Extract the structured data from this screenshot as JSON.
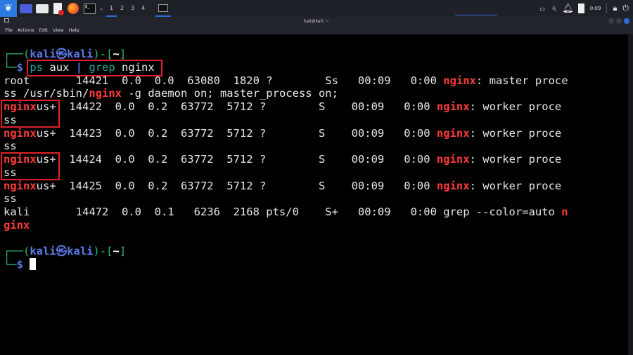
{
  "taskbar": {
    "workspaces": [
      "1",
      "2",
      "3",
      "4"
    ],
    "clock": "0:09"
  },
  "window": {
    "title": "kali@kali: ~",
    "menu": [
      "File",
      "Actions",
      "Edit",
      "View",
      "Help"
    ]
  },
  "prompt": {
    "top_open": "┌──(",
    "user": "kali㉿kali",
    "mid": ")-[",
    "dir": "~",
    "close": "]",
    "bottom": "└─",
    "dollar": "$"
  },
  "command": {
    "ps": "ps",
    "args": " aux ",
    "pipe": "|",
    "grep": "grep",
    "pattern": " nginx"
  },
  "output": [
    {
      "pre": "root       14421  0.0  0.0  63080  1820 ?        Ss   00:09   0:00 ",
      "hl": "nginx",
      "post": ": master proce"
    },
    {
      "pre": "ss /usr/sbin/",
      "hl": "nginx",
      "post": " -g daemon on; master_process on;"
    },
    {
      "pre": "",
      "hl": "nginx",
      "post": "us+  14422  0.0  0.2  63772  5712 ?        S    00:09   0:00 ",
      "hl2": "nginx",
      "post2": ": worker proce"
    },
    {
      "pre": "ss",
      "hl": "",
      "post": ""
    },
    {
      "pre": "",
      "hl": "nginx",
      "post": "us+  14423  0.0  0.2  63772  5712 ?        S    00:09   0:00 ",
      "hl2": "nginx",
      "post2": ": worker proce"
    },
    {
      "pre": "ss",
      "hl": "",
      "post": ""
    },
    {
      "pre": "",
      "hl": "nginx",
      "post": "us+  14424  0.0  0.2  63772  5712 ?        S    00:09   0:00 ",
      "hl2": "nginx",
      "post2": ": worker proce"
    },
    {
      "pre": "ss",
      "hl": "",
      "post": ""
    },
    {
      "pre": "",
      "hl": "nginx",
      "post": "us+  14425  0.0  0.2  63772  5712 ?        S    00:09   0:00 ",
      "hl2": "nginx",
      "post2": ": worker proce"
    },
    {
      "pre": "ss",
      "hl": "",
      "post": ""
    },
    {
      "pre": "kali       14472  0.0  0.1   6236  2168 pts/0    S+   00:09   0:00 grep --color=auto ",
      "hl": "n",
      "post": ""
    },
    {
      "pre": "",
      "hl": "ginx",
      "post": ""
    }
  ]
}
